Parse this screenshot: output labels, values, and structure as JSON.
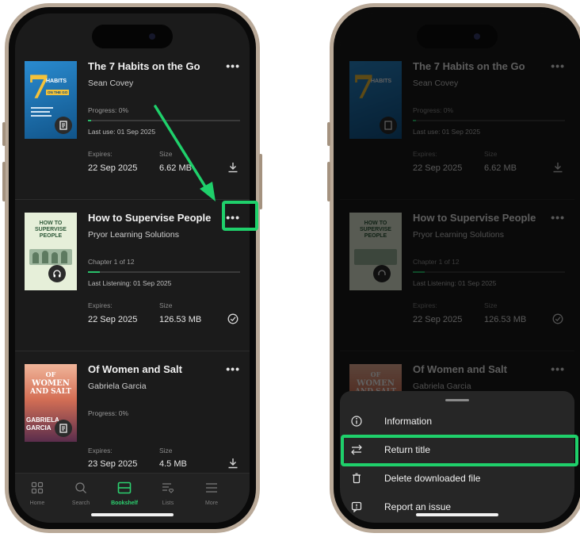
{
  "library": {
    "books": [
      {
        "title": "The 7 Habits on the Go",
        "author": "Sean Covey",
        "progress_text": "Progress: 0%",
        "progress": 0.02,
        "last_text": "Last use: 01 Sep 2025",
        "expires_label": "Expires:",
        "expires": "22 Sep 2025",
        "size_label": "Size",
        "size": "6.62 MB",
        "type_icon": "ebook-icon",
        "action_icon": "download-icon"
      },
      {
        "title": "How to Supervise People",
        "author": "Pryor Learning Solutions",
        "progress_text": "Chapter 1 of 12",
        "progress": 0.08,
        "last_text": "Last Listening: 01 Sep 2025",
        "expires_label": "Expires:",
        "expires": "22 Sep 2025",
        "size_label": "Size",
        "size": "126.53 MB",
        "type_icon": "headphones-icon",
        "action_icon": "downloaded-check-icon"
      },
      {
        "title": "Of Women and Salt",
        "author": "Gabriela Garcia",
        "progress_text": "Progress: 0%",
        "progress": 0,
        "last_text": "",
        "expires_label": "Expires:",
        "expires": "23 Sep 2025",
        "size_label": "Size",
        "size": "4.5 MB",
        "type_icon": "ebook-icon",
        "action_icon": "download-icon"
      }
    ],
    "covers": {
      "book1": {
        "number": "7",
        "word": "HABITS",
        "sub": "ON THE GO"
      },
      "book2": {
        "line1": "HOW TO",
        "line2": "SUPERVISE",
        "line3": "PEOPLE"
      },
      "book3": {
        "line1": "OF",
        "line2": "WOMEN",
        "line3": "AND SALT",
        "line4": "GABRIELA",
        "line5": "GARCIA"
      }
    }
  },
  "tabbar": {
    "tabs": [
      {
        "label": "Home",
        "icon": "home-grid-icon"
      },
      {
        "label": "Search",
        "icon": "search-icon"
      },
      {
        "label": "Bookshelf",
        "icon": "bookshelf-icon",
        "active": true
      },
      {
        "label": "Lists",
        "icon": "lists-icon"
      },
      {
        "label": "More",
        "icon": "menu-icon"
      }
    ]
  },
  "sheet": {
    "items": [
      {
        "label": "Information",
        "icon": "info-icon"
      },
      {
        "label": "Return title",
        "icon": "swap-arrows-icon",
        "highlighted": true
      },
      {
        "label": "Delete downloaded file",
        "icon": "trash-icon"
      },
      {
        "label": "Report an issue",
        "icon": "report-icon"
      }
    ]
  },
  "colors": {
    "accent": "#29c06a",
    "highlight": "#1fd06b",
    "background": "#1b1b1b"
  }
}
